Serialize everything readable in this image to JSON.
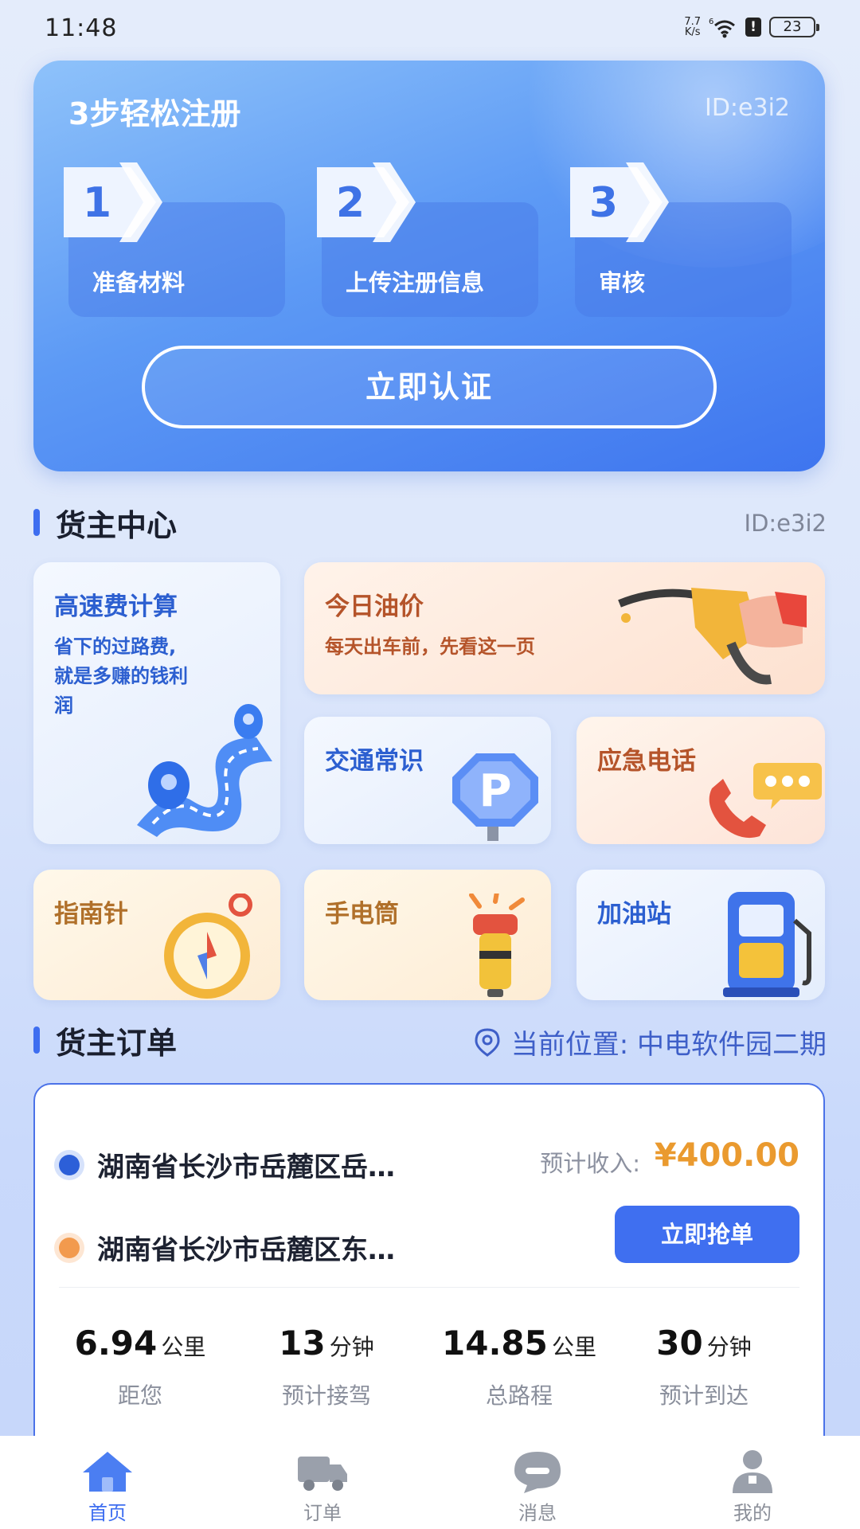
{
  "status_bar": {
    "time": "11:48",
    "net_speed_top": "7.7",
    "net_speed_bottom": "K/s",
    "signal_label": "6",
    "battery": "23"
  },
  "register": {
    "title": "3步轻松注册",
    "id": "ID:e3i2",
    "steps": [
      {
        "number": "1",
        "label": "准备材料"
      },
      {
        "number": "2",
        "label": "上传注册信息"
      },
      {
        "number": "3",
        "label": "审核"
      }
    ],
    "button": "立即认证"
  },
  "owner_center": {
    "title": "货主中心",
    "id": "ID:e3i2",
    "tiles": {
      "toll": {
        "title": "高速费计算",
        "sub1": "省下的过路费,",
        "sub2": "就是多赚的钱利",
        "sub3": "润"
      },
      "oil": {
        "title": "今日油价",
        "sub": "每天出车前，先看这一页"
      },
      "traffic": {
        "title": "交通常识"
      },
      "emergency": {
        "title": "应急电话"
      },
      "compass": {
        "title": "指南针"
      },
      "flashlight": {
        "title": "手电筒"
      },
      "gas_station": {
        "title": "加油站"
      }
    }
  },
  "orders": {
    "title": "货主订单",
    "location": "当前位置: 中电软件园二期",
    "card": {
      "from": "湖南省长沙市岳麓区岳…",
      "to": "湖南省长沙市岳麓区东…",
      "income_label": "预计收入:",
      "income_value": "¥400.00",
      "grab_button": "立即抢单",
      "stats": [
        {
          "value": "6.94",
          "unit": "公里",
          "label": "距您"
        },
        {
          "value": "13",
          "unit": "分钟",
          "label": "预计接驾"
        },
        {
          "value": "14.85",
          "unit": "公里",
          "label": "总路程"
        },
        {
          "value": "30",
          "unit": "分钟",
          "label": "预计到达"
        }
      ]
    }
  },
  "nav": [
    {
      "label": "首页",
      "icon": "home-icon",
      "active": true
    },
    {
      "label": "订单",
      "icon": "truck-icon"
    },
    {
      "label": "消息",
      "icon": "message-icon"
    },
    {
      "label": "我的",
      "icon": "user-icon"
    }
  ],
  "colors": {
    "primary": "#3E6EF0",
    "income": "#EA9A2F",
    "from_dot": "#2C5FD8",
    "to_dot": "#F29A4E"
  }
}
